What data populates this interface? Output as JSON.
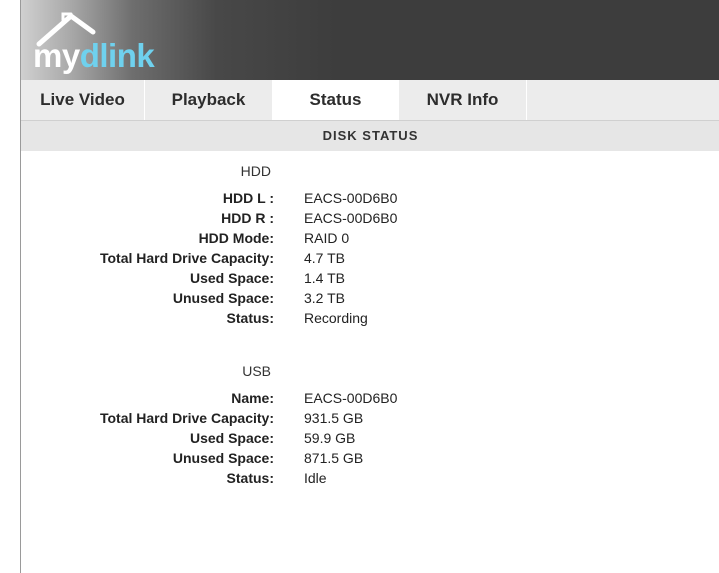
{
  "header": {
    "logo": {
      "my": "my",
      "dlink": "dlink"
    }
  },
  "tabs": [
    {
      "label": "Live Video",
      "active": false
    },
    {
      "label": "Playback",
      "active": false
    },
    {
      "label": "Status",
      "active": true
    },
    {
      "label": "NVR Info",
      "active": false
    }
  ],
  "section": {
    "title": "DISK STATUS"
  },
  "hdd": {
    "title": "HDD",
    "rows": [
      {
        "label": "HDD L :",
        "value": "EACS-00D6B0"
      },
      {
        "label": "HDD R :",
        "value": "EACS-00D6B0"
      },
      {
        "label": "HDD Mode:",
        "value": "RAID 0"
      },
      {
        "label": "Total Hard Drive Capacity:",
        "value": "4.7 TB"
      },
      {
        "label": "Used Space:",
        "value": "1.4 TB"
      },
      {
        "label": "Unused Space:",
        "value": "3.2 TB"
      },
      {
        "label": "Status:",
        "value": "Recording"
      }
    ]
  },
  "usb": {
    "title": "USB",
    "rows": [
      {
        "label": "Name:",
        "value": "EACS-00D6B0"
      },
      {
        "label": "Total Hard Drive Capacity:",
        "value": "931.5 GB"
      },
      {
        "label": "Used Space:",
        "value": "59.9 GB"
      },
      {
        "label": "Unused Space:",
        "value": "871.5 GB"
      },
      {
        "label": "Status:",
        "value": "Idle"
      }
    ]
  },
  "colors": {
    "accent_logo": "#6fd1ee",
    "header_dark": "#3d3d3d",
    "tab_bar": "#ececec",
    "section_bar": "#e6e6e6"
  }
}
